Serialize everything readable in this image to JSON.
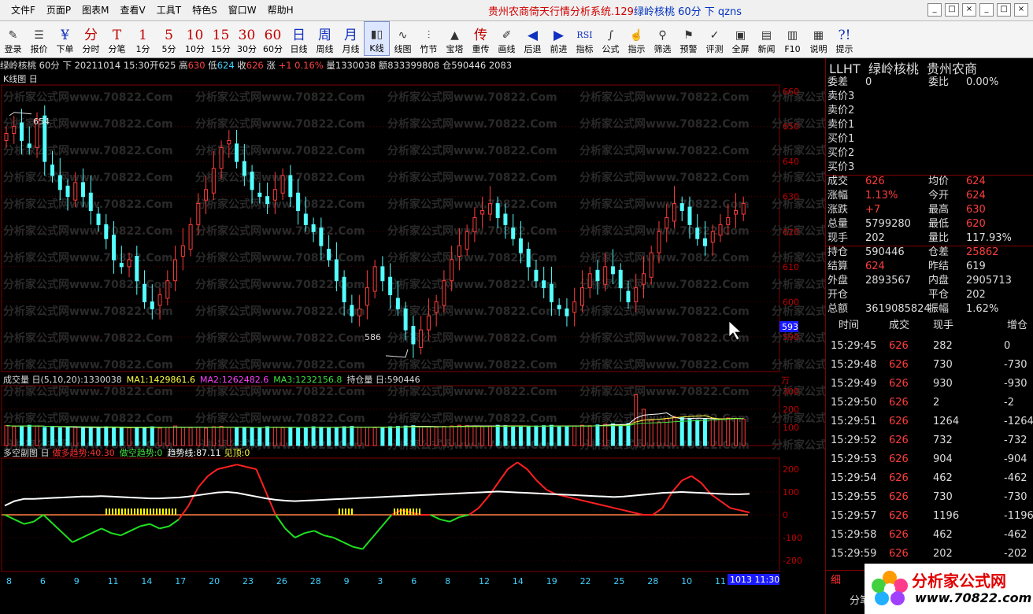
{
  "menu": [
    "文件F",
    "页面P",
    "图表M",
    "查看V",
    "工具T",
    "特色S",
    "窗口W",
    "帮助H"
  ],
  "title": {
    "main": "贵州农商倚天行情分析系统.129",
    "symbol": "绿岭核桃 60分 下 qzns"
  },
  "window_buttons": [
    "_",
    "□",
    "×",
    "_",
    "□",
    "×"
  ],
  "toolbar": [
    {
      "icon": "✎",
      "label": "登录",
      "style": "ico"
    },
    {
      "icon": "☰",
      "label": "报价",
      "style": "ico"
    },
    {
      "icon": "¥",
      "label": "下单",
      "style": "blue"
    },
    {
      "icon": "分",
      "label": "分时",
      "style": "red"
    },
    {
      "icon": "T",
      "label": "分笔",
      "style": "red"
    },
    {
      "icon": "1",
      "label": "1分",
      "style": "red"
    },
    {
      "icon": "5",
      "label": "5分",
      "style": "red"
    },
    {
      "icon": "10",
      "label": "10分",
      "style": "red"
    },
    {
      "icon": "15",
      "label": "15分",
      "style": "red"
    },
    {
      "icon": "30",
      "label": "30分",
      "style": "red"
    },
    {
      "icon": "60",
      "label": "60分",
      "style": "red"
    },
    {
      "icon": "日",
      "label": "日线",
      "style": "blue"
    },
    {
      "icon": "周",
      "label": "周线",
      "style": "blue"
    },
    {
      "icon": "月",
      "label": "月线",
      "style": "blue"
    },
    {
      "icon": "▮▯",
      "label": "K线",
      "style": "ico",
      "selected": true
    },
    {
      "icon": "∿",
      "label": "线图",
      "style": "ico"
    },
    {
      "icon": "⫶",
      "label": "竹节",
      "style": "ico"
    },
    {
      "icon": "▲",
      "label": "宝塔",
      "style": "ico"
    },
    {
      "icon": "传",
      "label": "重传",
      "style": "red"
    },
    {
      "icon": "✐",
      "label": "画线",
      "style": "ico"
    },
    {
      "icon": "◀",
      "label": "后退",
      "style": "blue"
    },
    {
      "icon": "▶",
      "label": "前进",
      "style": "blue"
    },
    {
      "icon": "RSI",
      "label": "指标",
      "style": "blue"
    },
    {
      "icon": "∫",
      "label": "公式",
      "style": "ico"
    },
    {
      "icon": "☝",
      "label": "指示",
      "style": "ico"
    },
    {
      "icon": "⚲",
      "label": "筛选",
      "style": "ico"
    },
    {
      "icon": "⚑",
      "label": "预警",
      "style": "ico"
    },
    {
      "icon": "✓",
      "label": "评测",
      "style": "ico"
    },
    {
      "icon": "▣",
      "label": "全屏",
      "style": "ico"
    },
    {
      "icon": "▤",
      "label": "新闻",
      "style": "ico"
    },
    {
      "icon": "▥",
      "label": "F10",
      "style": "ico"
    },
    {
      "icon": "▦",
      "label": "说明",
      "style": "ico"
    },
    {
      "icon": "?!",
      "label": "提示",
      "style": "blue"
    }
  ],
  "info": {
    "name": "绿岭核桃",
    "period": "60分",
    "dir": "下",
    "date": "20211014",
    "time": "15:30",
    "open_label": "开",
    "open": "625",
    "high_label": "高",
    "high": "630",
    "low_label": "低",
    "low": "624",
    "close_label": "收",
    "close": "626",
    "chg_label": "涨",
    "chg": "+1",
    "pct": "0.16%",
    "vol_label": "量",
    "vol": "1330038",
    "amt_label": "额",
    "amt": "833399808",
    "oi_label": "仓",
    "oi": "590446",
    "oi2": "2083"
  },
  "panels": {
    "kline_title": "K线图 日",
    "vol_title": "成交量 日(5,10,20)",
    "vol_value": ":1330038",
    "ma1": "MA1:1429861.6",
    "ma2": "MA2:1262482.6",
    "ma3": "MA3:1232156.8",
    "oi_title": "持仓量 日:590446",
    "osc_title": "多空副图 日",
    "osc_bull": "做多趋势:40.30",
    "osc_bear": "做空趋势:0",
    "osc_trend": "趋势线:87.11",
    "osc_top": "见顶:0",
    "price_axis": [
      "660",
      "650",
      "640",
      "630",
      "620",
      "610",
      "600",
      "590"
    ],
    "vol_axis": [
      "300",
      "200",
      "100"
    ],
    "vol_unit": "万",
    "osc_axis": [
      "200",
      "100",
      "0",
      "-100",
      "-200"
    ],
    "high_mark": "654",
    "low_mark": "586",
    "last_price_tag": "593",
    "date_axis": [
      "8",
      "6",
      "9",
      "11",
      "14",
      "17",
      "20",
      "23",
      "26",
      "28",
      "9",
      "3",
      "6",
      "8",
      "12",
      "14",
      "19",
      "22",
      "25",
      "28",
      "10",
      "11"
    ],
    "date_tag": "1013 11:30",
    "watermark": "分析家公式网www.70822.Com"
  },
  "right": {
    "header": [
      "LLHT",
      "绿岭核桃",
      "贵州农商"
    ],
    "book": [
      {
        "l": "委差",
        "v": "0",
        "l2": "委比",
        "v2": "0.00%"
      },
      {
        "l": "卖价3",
        "v": "",
        "l2": "",
        "v2": ""
      },
      {
        "l": "卖价2",
        "v": "",
        "l2": "",
        "v2": ""
      },
      {
        "l": "卖价1",
        "v": "",
        "l2": "",
        "v2": ""
      },
      {
        "l": "买价1",
        "v": "",
        "l2": "",
        "v2": ""
      },
      {
        "l": "买价2",
        "v": "",
        "l2": "",
        "v2": ""
      },
      {
        "l": "买价3",
        "v": "",
        "l2": "",
        "v2": ""
      }
    ],
    "stats": [
      {
        "l": "成交",
        "v": "626",
        "c": "r",
        "l2": "均价",
        "v2": "624",
        "c2": "r"
      },
      {
        "l": "涨幅",
        "v": "1.13%",
        "c": "r",
        "l2": "今开",
        "v2": "624",
        "c2": "r"
      },
      {
        "l": "涨跌",
        "v": "+7",
        "c": "r",
        "l2": "最高",
        "v2": "630",
        "c2": "r"
      },
      {
        "l": "总量",
        "v": "5799280",
        "c": "w",
        "l2": "最低",
        "v2": "620",
        "c2": "r"
      },
      {
        "l": "现手",
        "v": "202",
        "c": "w",
        "l2": "量比",
        "v2": "117.93%",
        "c2": "w"
      },
      {
        "l": "持仓",
        "v": "590446",
        "c": "w",
        "l2": "仓差",
        "v2": "25862",
        "c2": "r"
      },
      {
        "l": "结算",
        "v": "624",
        "c": "r",
        "l2": "昨结",
        "v2": "619",
        "c2": "w"
      },
      {
        "l": "外盘",
        "v": "2893567",
        "c": "w",
        "l2": "内盘",
        "v2": "2905713",
        "c2": "w"
      },
      {
        "l": "开仓",
        "v": "",
        "c": "w",
        "l2": "平仓",
        "v2": "202",
        "c2": "w"
      },
      {
        "l": "总额",
        "v": "3619085824",
        "c": "w",
        "l2": "振幅",
        "v2": "1.62%",
        "c2": "w"
      }
    ],
    "tick_header": [
      "时间",
      "成交",
      "现手",
      "增仓"
    ],
    "ticks": [
      [
        "15:29:45",
        "626",
        "282",
        "0"
      ],
      [
        "15:29:48",
        "626",
        "730",
        "-730"
      ],
      [
        "15:29:49",
        "626",
        "930",
        "-930"
      ],
      [
        "15:29:50",
        "626",
        "2",
        "-2"
      ],
      [
        "15:29:51",
        "626",
        "1264",
        "-1264"
      ],
      [
        "15:29:52",
        "626",
        "732",
        "-732"
      ],
      [
        "15:29:53",
        "626",
        "904",
        "-904"
      ],
      [
        "15:29:54",
        "626",
        "462",
        "-462"
      ],
      [
        "15:29:55",
        "626",
        "730",
        "-730"
      ],
      [
        "15:29:57",
        "626",
        "1196",
        "-1196"
      ],
      [
        "15:29:58",
        "626",
        "462",
        "-462"
      ],
      [
        "15:29:59",
        "626",
        "202",
        "-202"
      ]
    ],
    "tabs": [
      "细",
      "分笔"
    ],
    "logo_text": "分析家公式网",
    "logo_url": "www.70822.com"
  },
  "colors": {
    "up": "#ff3c3c",
    "down": "#54ffff",
    "grid": "#800000",
    "axis": "#c00000"
  },
  "chart_data": {
    "type": "candlestick",
    "close_series": [
      648,
      650,
      646,
      644,
      652,
      640,
      636,
      632,
      630,
      634,
      630,
      626,
      622,
      618,
      612,
      610,
      612,
      606,
      600,
      598,
      602,
      606,
      612,
      616,
      622,
      628,
      632,
      638,
      644,
      646,
      640,
      636,
      632,
      630,
      628,
      632,
      636,
      630,
      626,
      622,
      620,
      616,
      612,
      606,
      600,
      596,
      598,
      604,
      610,
      606,
      602,
      598,
      592,
      588,
      592,
      596,
      600,
      606,
      612,
      616,
      620,
      624,
      626,
      628,
      624,
      622,
      618,
      614,
      610,
      606,
      604,
      600,
      598,
      596,
      600,
      604,
      608,
      606,
      610,
      608,
      604,
      600,
      604,
      608,
      614,
      620,
      624,
      628,
      626,
      622,
      618,
      616,
      620,
      622,
      624,
      626,
      628
    ],
    "volume_series": [
      110,
      105,
      108,
      112,
      106,
      100,
      104,
      98,
      102,
      100,
      96,
      100,
      98,
      104,
      100,
      96,
      98,
      102,
      100,
      104,
      96,
      100,
      108,
      102,
      98,
      100,
      96,
      104,
      106,
      100,
      102,
      98,
      96,
      100,
      104,
      102,
      98,
      100,
      96,
      100,
      104,
      102,
      100,
      98,
      104,
      106,
      100,
      102,
      98,
      100,
      104,
      106,
      108,
      110,
      102,
      104,
      100,
      106,
      108,
      112,
      110,
      106,
      104,
      108,
      112,
      110,
      106,
      104,
      102,
      108,
      110,
      112,
      106,
      104,
      108,
      112,
      110,
      114,
      118,
      120,
      116,
      122,
      280,
      200,
      140,
      130,
      150,
      160,
      155,
      150,
      140,
      145,
      150,
      148,
      152,
      150,
      146
    ],
    "oscillator": {
      "red_line": [
        0,
        -20,
        -40,
        -30,
        0,
        -40,
        -80,
        -120,
        -100,
        -80,
        -60,
        -80,
        -90,
        -70,
        -50,
        -40,
        -60,
        -50,
        -20,
        40,
        120,
        170,
        200,
        210,
        220,
        210,
        200,
        100,
        0,
        -60,
        -100,
        -80,
        -70,
        -90,
        -100,
        -120,
        -140,
        -150,
        -100,
        -50,
        0,
        20,
        10,
        0,
        0,
        -20,
        -30,
        -10,
        0,
        30,
        80,
        140,
        200,
        230,
        200,
        150,
        110,
        90,
        80,
        70,
        60,
        50,
        40,
        30,
        20,
        10,
        0,
        0,
        30,
        100,
        150,
        170,
        140,
        90,
        60,
        30,
        20,
        10
      ],
      "white_line": [
        40,
        60,
        70,
        70,
        72,
        74,
        76,
        78,
        80,
        80,
        82,
        80,
        78,
        76,
        74,
        72,
        72,
        74,
        76,
        80,
        86,
        92,
        98,
        100,
        96,
        88,
        80,
        72,
        66,
        62,
        60,
        62,
        64,
        66,
        68,
        70,
        72,
        74,
        76,
        78,
        80,
        82,
        84,
        86,
        88,
        90,
        92,
        94,
        96,
        98,
        100,
        102,
        100,
        98,
        96,
        94,
        92,
        90,
        88,
        86,
        84,
        82,
        80,
        78,
        80,
        84,
        88,
        92,
        96,
        98,
        100,
        98,
        96,
        94,
        92,
        90,
        90,
        92
      ]
    }
  }
}
